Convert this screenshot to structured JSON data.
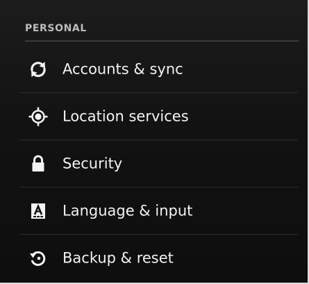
{
  "section": {
    "title": "PERSONAL"
  },
  "items": [
    {
      "label": "Accounts & sync",
      "icon": "sync-icon"
    },
    {
      "label": "Location services",
      "icon": "location-icon"
    },
    {
      "label": "Security",
      "icon": "lock-icon"
    },
    {
      "label": "Language & input",
      "icon": "keyboard-icon"
    },
    {
      "label": "Backup & reset",
      "icon": "backup-restore-icon"
    }
  ],
  "colors": {
    "background": "#121212",
    "text": "#f2f2f2",
    "section_text": "#bdbdbd",
    "divider": "#2e2e2e"
  }
}
